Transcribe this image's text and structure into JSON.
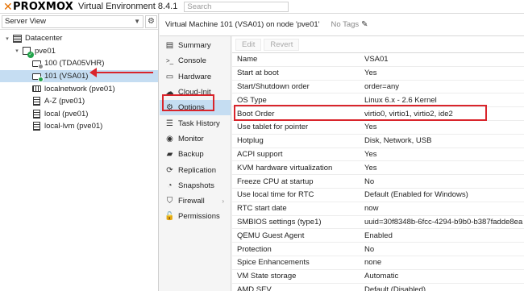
{
  "header": {
    "logo_text": "PROXMOX",
    "product": "Virtual Environment 8.4.1",
    "search_placeholder": "Search"
  },
  "left": {
    "view_select": "Server View",
    "tree": [
      {
        "label": "Datacenter",
        "icon": "datacenter-icon",
        "level": 0,
        "twist": "▾"
      },
      {
        "label": "pve01",
        "icon": "host-icon",
        "level": 1,
        "twist": "▾"
      },
      {
        "label": "100 (TDA05VHR)",
        "icon": "vm-stopped-icon",
        "level": 2,
        "twist": ""
      },
      {
        "label": "101 (VSA01)",
        "icon": "vm-running-icon",
        "level": 2,
        "twist": "",
        "selected": true
      },
      {
        "label": "localnetwork (pve01)",
        "icon": "network-icon",
        "level": 2,
        "twist": ""
      },
      {
        "label": "A-Z (pve01)",
        "icon": "storage-icon",
        "level": 2,
        "twist": ""
      },
      {
        "label": "local (pve01)",
        "icon": "storage-icon",
        "level": 2,
        "twist": ""
      },
      {
        "label": "local-lvm (pve01)",
        "icon": "storage-icon",
        "level": 2,
        "twist": ""
      }
    ]
  },
  "title": {
    "text": "Virtual Machine 101 (VSA01) on node 'pve01'",
    "tags": "No Tags"
  },
  "menu": [
    {
      "label": "Summary",
      "icon": "summary-icon",
      "glyph": "▤"
    },
    {
      "label": "Console",
      "icon": "console-icon",
      "glyph": ">_"
    },
    {
      "label": "Hardware",
      "icon": "hardware-icon",
      "glyph": "▭"
    },
    {
      "label": "Cloud-Init",
      "icon": "cloud-icon",
      "glyph": "☁"
    },
    {
      "label": "Options",
      "icon": "gear-icon",
      "glyph": "⚙",
      "active": true
    },
    {
      "label": "Task History",
      "icon": "task-history-icon",
      "glyph": "☰"
    },
    {
      "label": "Monitor",
      "icon": "monitor-icon",
      "glyph": "◉"
    },
    {
      "label": "Backup",
      "icon": "backup-icon",
      "glyph": "▰"
    },
    {
      "label": "Replication",
      "icon": "replication-icon",
      "glyph": "⟳"
    },
    {
      "label": "Snapshots",
      "icon": "snapshots-icon",
      "glyph": "◔"
    },
    {
      "label": "Firewall",
      "icon": "firewall-icon",
      "glyph": "⛉",
      "more": "›"
    },
    {
      "label": "Permissions",
      "icon": "permissions-icon",
      "glyph": "🔓"
    }
  ],
  "toolbar": {
    "edit": "Edit",
    "revert": "Revert"
  },
  "options": [
    {
      "key": "Name",
      "value": "VSA01"
    },
    {
      "key": "Start at boot",
      "value": "Yes"
    },
    {
      "key": "Start/Shutdown order",
      "value": "order=any"
    },
    {
      "key": "OS Type",
      "value": "Linux 6.x - 2.6 Kernel"
    },
    {
      "key": "Boot Order",
      "value": "virtio0, virtio1, virtio2, ide2"
    },
    {
      "key": "Use tablet for pointer",
      "value": "Yes"
    },
    {
      "key": "Hotplug",
      "value": "Disk, Network, USB"
    },
    {
      "key": "ACPI support",
      "value": "Yes"
    },
    {
      "key": "KVM hardware virtualization",
      "value": "Yes"
    },
    {
      "key": "Freeze CPU at startup",
      "value": "No"
    },
    {
      "key": "Use local time for RTC",
      "value": "Default (Enabled for Windows)"
    },
    {
      "key": "RTC start date",
      "value": "now"
    },
    {
      "key": "SMBIOS settings (type1)",
      "value": "uuid=30f8348b-6fcc-4294-b9b0-b387fadde8ea"
    },
    {
      "key": "QEMU Guest Agent",
      "value": "Enabled"
    },
    {
      "key": "Protection",
      "value": "No"
    },
    {
      "key": "Spice Enhancements",
      "value": "none"
    },
    {
      "key": "VM State storage",
      "value": "Automatic"
    },
    {
      "key": "AMD SEV",
      "value": "Default (Disabled)"
    }
  ],
  "colors": {
    "selection": "#c5ddf2",
    "annotation_red": "#d9242b",
    "running_green": "#21a34a",
    "logo_orange": "#e57000"
  }
}
